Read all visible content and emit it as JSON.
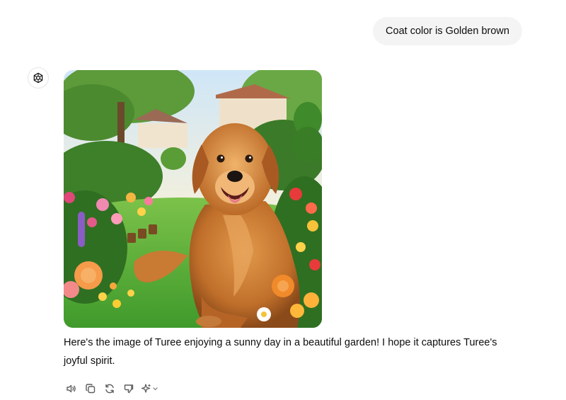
{
  "user_message": {
    "text": "Coat color is Golden brown"
  },
  "assistant": {
    "avatar_icon": "openai-logo-icon",
    "image_subject": "golden-retriever-in-garden",
    "message_text": "Here's the image of Turee enjoying a sunny day in a beautiful garden! I hope it captures Turee's joyful spirit."
  },
  "actions": [
    {
      "icon": "speaker-icon"
    },
    {
      "icon": "copy-icon"
    },
    {
      "icon": "regenerate-icon"
    },
    {
      "icon": "thumbs-down-icon"
    },
    {
      "icon": "sparkle-model-icon"
    }
  ],
  "colors": {
    "user_bubble_bg": "#f4f4f4",
    "text": "#0d0d0d",
    "icon": "#5d5d5d"
  }
}
